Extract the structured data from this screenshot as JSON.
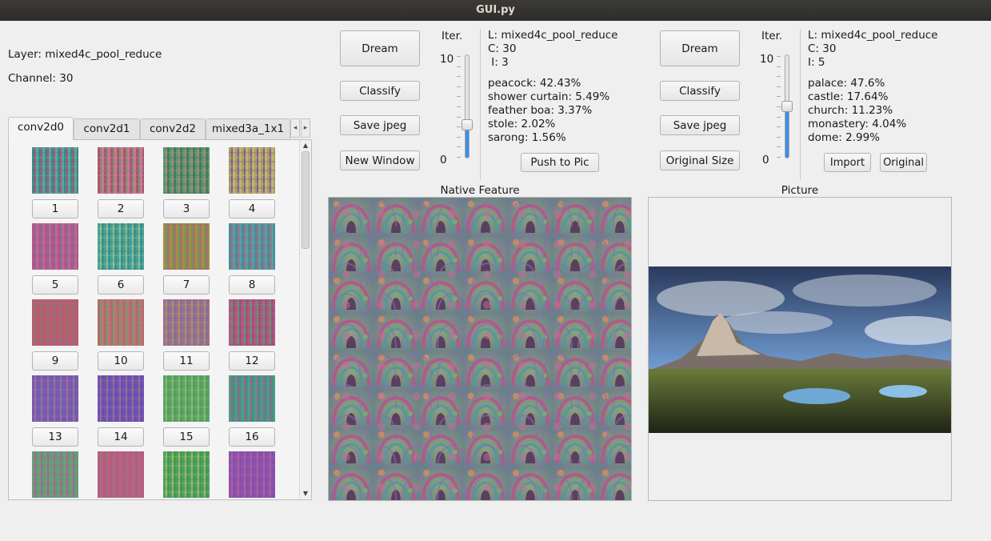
{
  "window": {
    "title": "GUI.py"
  },
  "left": {
    "layer_label": "Layer: mixed4c_pool_reduce",
    "channel_label": "Channel: 30",
    "tabs": [
      {
        "label": "conv2d0",
        "active": true
      },
      {
        "label": "conv2d1",
        "active": false
      },
      {
        "label": "conv2d2",
        "active": false
      },
      {
        "label": "mixed3a_1x1",
        "active": false
      }
    ],
    "scroll_left_glyph": "◂",
    "scroll_right_glyph": "▸",
    "scroll_up_glyph": "▲",
    "scroll_down_glyph": "▼",
    "channels": [
      {
        "label": "1",
        "colors": [
          "#2e8f80",
          "#b04f86",
          "#5aa79d"
        ]
      },
      {
        "label": "2",
        "colors": [
          "#b0506c",
          "#7f8d6a",
          "#c47a9b"
        ]
      },
      {
        "label": "3",
        "colors": [
          "#5c9a6f",
          "#a7887e",
          "#3f7f5a"
        ]
      },
      {
        "label": "4",
        "colors": [
          "#a8a05a",
          "#7e5f9a",
          "#c0b271"
        ]
      },
      {
        "label": "5",
        "colors": [
          "#c04f86",
          "#7e6aa3",
          "#b96b8d"
        ]
      },
      {
        "label": "6",
        "colors": [
          "#47a390",
          "#8fbf8f",
          "#3a8f92"
        ]
      },
      {
        "label": "7",
        "colors": [
          "#a79040",
          "#6a9a5a",
          "#a8706a"
        ]
      },
      {
        "label": "8",
        "colors": [
          "#3b8fa5",
          "#a56a7a",
          "#5a9fa0"
        ]
      },
      {
        "label": "9",
        "colors": [
          "#c05a6f",
          "#8a7a6a",
          "#b85a7a"
        ]
      },
      {
        "label": "10",
        "colors": [
          "#b06a66",
          "#7a9a70",
          "#c0707a"
        ]
      },
      {
        "label": "11",
        "colors": [
          "#a86a8a",
          "#9a9a6a",
          "#8f6a9a"
        ]
      },
      {
        "label": "12",
        "colors": [
          "#c0508a",
          "#5a9a70",
          "#a0507a"
        ]
      },
      {
        "label": "13",
        "colors": [
          "#7e55b0",
          "#a0709a",
          "#6a60b0"
        ]
      },
      {
        "label": "14",
        "colors": [
          "#7050b8",
          "#9a7090",
          "#6650b0"
        ]
      },
      {
        "label": "15",
        "colors": [
          "#5aa46a",
          "#8fba6a",
          "#4f9f60"
        ]
      },
      {
        "label": "16",
        "colors": [
          "#4aa08a",
          "#a0608a",
          "#3f9585"
        ]
      },
      {
        "label": "",
        "colors": [
          "#6ba070",
          "#b06090",
          "#5aa080"
        ]
      },
      {
        "label": "",
        "colors": [
          "#b06075",
          "#a07090",
          "#c05a80"
        ]
      },
      {
        "label": "",
        "colors": [
          "#4fa060",
          "#9fb86a",
          "#3f9a55"
        ]
      },
      {
        "label": "",
        "colors": [
          "#9050a8",
          "#b060a0",
          "#8050b0"
        ]
      }
    ]
  },
  "native": {
    "dream_label": "Dream",
    "classify_label": "Classify",
    "save_label": "Save jpeg",
    "new_window_label": "New Window",
    "iter_label": "Iter.",
    "iter_max": "10",
    "iter_min": "0",
    "iter_value": 3,
    "info": {
      "layer": "L: mixed4c_pool_reduce",
      "channel": "C: 30",
      "iter": " I: 3"
    },
    "predictions": [
      "peacock: 42.43%",
      "shower curtain: 5.49%",
      "feather boa: 3.37%",
      "stole: 2.02%",
      "sarong: 1.56%"
    ],
    "push_label": "Push to Pic",
    "frame_title": "Native Feature"
  },
  "picture": {
    "dream_label": "Dream",
    "classify_label": "Classify",
    "save_label": "Save jpeg",
    "original_size_label": "Original Size",
    "iter_label": "Iter.",
    "iter_max": "10",
    "iter_min": "0",
    "iter_value": 5,
    "info": {
      "layer": "L: mixed4c_pool_reduce",
      "channel": "C: 30",
      "iter": "I: 5"
    },
    "predictions": [
      "palace: 47.6%",
      "castle: 17.64%",
      "church: 11.23%",
      "monastery: 4.04%",
      "dome: 2.99%"
    ],
    "import_label": "Import",
    "original_label": "Original",
    "frame_title": "Picture"
  },
  "colors": {
    "slider_fill": "#3d8ee0",
    "titlebar": "#2d2c29"
  }
}
